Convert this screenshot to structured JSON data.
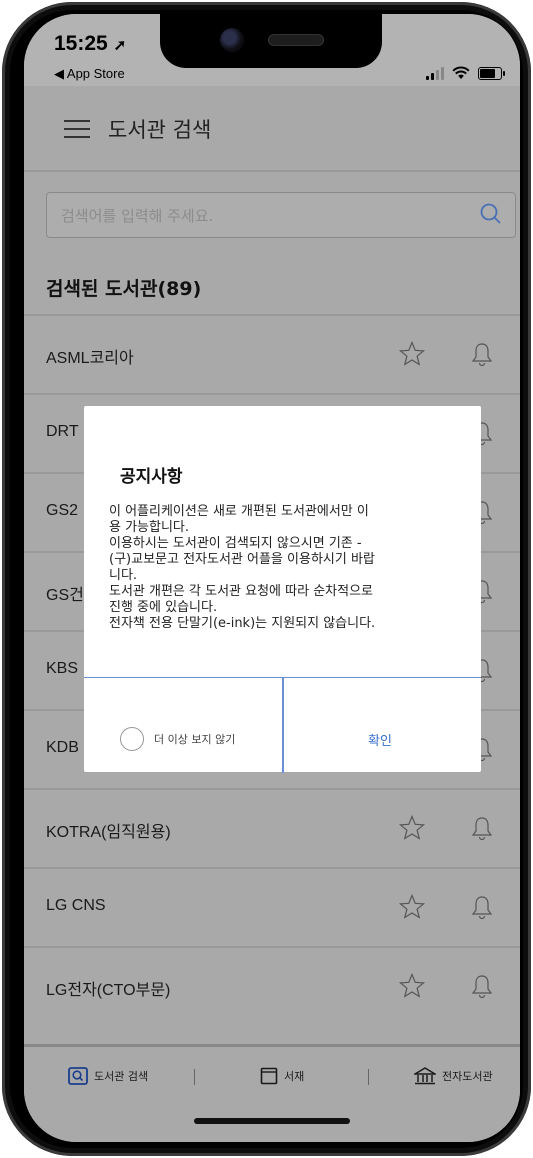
{
  "status_bar": {
    "time": "15:25",
    "location_glyph": "➚",
    "back_app": "◀ App Store"
  },
  "app_bar": {
    "title": "도서관 검색"
  },
  "search": {
    "placeholder": "검색어를 입력해 주세요."
  },
  "results": {
    "heading": "검색된 도서관(89)",
    "items": [
      {
        "label": "ASML코리아"
      },
      {
        "label": "DRT"
      },
      {
        "label": "GS2"
      },
      {
        "label": "GS건"
      },
      {
        "label": "KBS"
      },
      {
        "label": "KDB"
      },
      {
        "label": "KOTRA(임직원용)"
      },
      {
        "label": "LG CNS"
      },
      {
        "label": "LG전자(CTO부문)"
      }
    ]
  },
  "tabbar": {
    "items": [
      {
        "label": "도서관 검색",
        "icon": "search-icon"
      },
      {
        "label": "서재",
        "icon": "book-icon"
      },
      {
        "label": "전자도서관",
        "icon": "library-icon"
      }
    ]
  },
  "modal": {
    "title": "공지사항",
    "lines": [
      "이 어플리케이션은 새로 개편된 도서관에서만 이",
      "용 가능합니다.",
      "이용하시는 도서관이 검색되지 않으시면 기존 -",
      "(구)교보문고 전자도서관 어플을 이용하시기 바랍",
      "니다.",
      "도서관 개편은 각 도서관 요청에 따라 순차적으로",
      "진행 중에 있습니다.",
      "전자책 전용 단말기(e-ink)는 지원되지 않습니다."
    ],
    "dont_show_label": "더 이상 보지 않기",
    "confirm_label": "확인"
  },
  "colors": {
    "overlay": "#a9a9a9",
    "accent": "#3a6fd0"
  }
}
